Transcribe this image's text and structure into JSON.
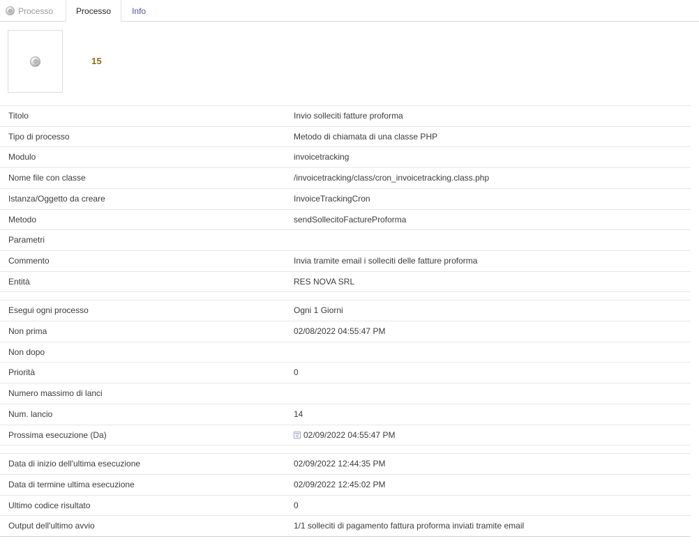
{
  "tabs": [
    {
      "label": "Processo",
      "icon": "object-bullet-icon",
      "state": "title"
    },
    {
      "label": "Processo",
      "icon": "",
      "state": "active"
    },
    {
      "label": "Info",
      "icon": "",
      "state": "link"
    }
  ],
  "header": {
    "thumbnail_icon": "object-bullet-icon",
    "ref_id": "15",
    "ref_id_color": "#8a6d13"
  },
  "details": {
    "sections": [
      {
        "rows": [
          {
            "label": "Titolo",
            "value": "Invio solleciti fatture proforma"
          },
          {
            "label": "Tipo di processo",
            "value": "Metodo di chiamata di una classe PHP"
          },
          {
            "label": "Modulo",
            "value": "invoicetracking"
          },
          {
            "label": "Nome file con classe",
            "value": "/invoicetracking/class/cron_invoicetracking.class.php"
          },
          {
            "label": "Istanza/Oggetto da creare",
            "value": "InvoiceTrackingCron"
          },
          {
            "label": "Metodo",
            "value": "sendSollecitoFactureProforma"
          },
          {
            "label": "Parametri",
            "value": ""
          },
          {
            "label": "Commento",
            "value": "Invia tramite email i solleciti delle fatture proforma"
          },
          {
            "label": "Entità",
            "value": "RES NOVA SRL"
          }
        ]
      },
      {
        "rows": [
          {
            "label": "Esegui ogni processo",
            "value": "Ogni 1 Giorni"
          },
          {
            "label": "Non prima",
            "value": "02/08/2022 04:55:47 PM"
          },
          {
            "label": "Non dopo",
            "value": ""
          },
          {
            "label": "Priorità",
            "value": "0"
          },
          {
            "label": "Numero massimo di lanci",
            "value": ""
          },
          {
            "label": "Num. lancio",
            "value": "14"
          },
          {
            "label": "Prossima esecuzione (Da)",
            "value": "02/09/2022 04:55:47 PM",
            "icon": "calendar-icon"
          }
        ]
      },
      {
        "rows": [
          {
            "label": "Data di inizio dell'ultima esecuzione",
            "value": "02/09/2022 12:44:35 PM"
          },
          {
            "label": "Data di termine ultima esecuzione",
            "value": "02/09/2022 12:45:02 PM"
          },
          {
            "label": "Ultimo codice risultato",
            "value": "0"
          },
          {
            "label": "Output dell'ultimo avvio",
            "value": "1/1 solleciti di pagamento fattura proforma inviati tramite email"
          }
        ]
      }
    ]
  }
}
